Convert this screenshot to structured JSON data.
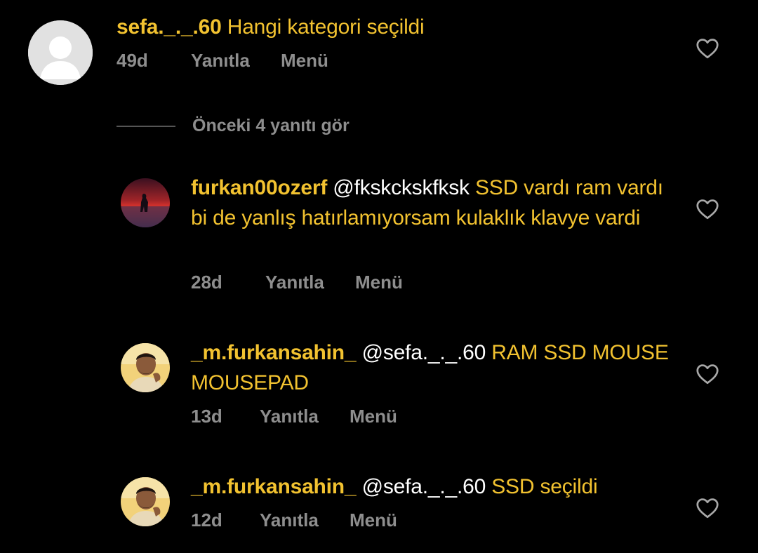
{
  "comments": [
    {
      "username": "sefa._._.60",
      "mention": "",
      "text": "Hangi kategori seçildi",
      "age": "49d",
      "reply_label": "Yanıtla",
      "menu_label": "Menü"
    },
    {
      "username": "furkan00ozerf",
      "mention": "@fkskckskfksk",
      "text": "SSD vardı ram vardı bi de yanlış hatırlamıyorsam kulaklık klavye vardi",
      "age": "28d",
      "reply_label": "Yanıtla",
      "menu_label": "Menü"
    },
    {
      "username": "_m.furkansahin_",
      "mention": "@sefa._._.60",
      "text": "RAM SSD MOUSE MOUSEPAD",
      "age": "13d",
      "reply_label": "Yanıtla",
      "menu_label": "Menü"
    },
    {
      "username": "_m.furkansahin_",
      "mention": "@sefa._._.60",
      "text": "SSD seçildi",
      "age": "12d",
      "reply_label": "Yanıtla",
      "menu_label": "Menü"
    }
  ],
  "view_previous_replies": "Önceki 4 yanıtı gör",
  "icons": {
    "like": "heart-outline-icon",
    "default_avatar": "default-avatar-icon"
  },
  "colors": {
    "background": "#000000",
    "comment_text": "#f2c230",
    "mention": "#ffffff",
    "meta": "#8e8e8e"
  }
}
